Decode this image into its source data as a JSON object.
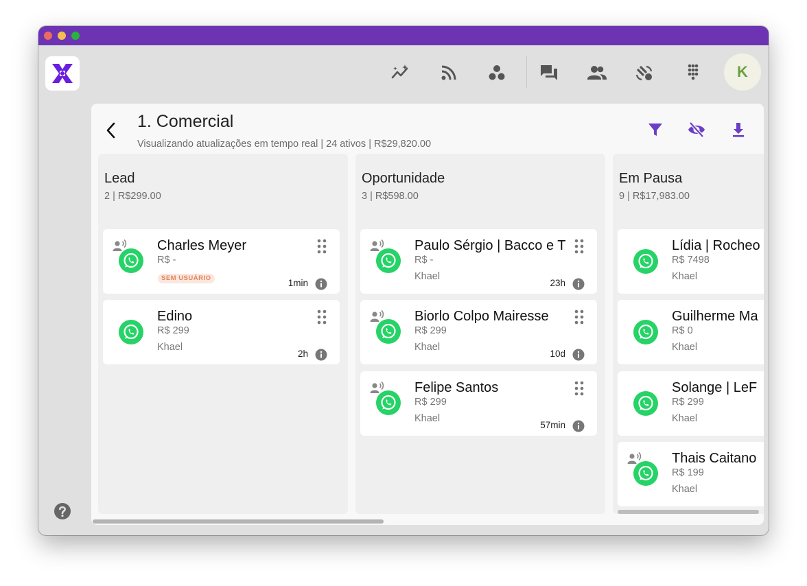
{
  "app": {
    "nav_icons": [
      "analytics-icon",
      "feed-icon",
      "workflow-icon",
      "chat-icon",
      "contacts-icon",
      "connections-icon",
      "apps-grid-icon"
    ],
    "avatar_initial": "K",
    "accent_color": "#6a3fc8",
    "titlebar_color": "#6c34b3",
    "whatsapp_color": "#25d366"
  },
  "board": {
    "title": "1. Comercial",
    "subtitle": "Visualizando atualizações em tempo real | 24 ativos | R$29,820.00",
    "columns": [
      {
        "title": "Lead",
        "meta": "2 | R$299.00",
        "cards": [
          {
            "name": "Charles Meyer",
            "value": "R$ -",
            "badge": "SEM USUÁRIO",
            "time": "1min"
          },
          {
            "name": "Edino",
            "value": "R$ 299",
            "user": "Khael",
            "time": "2h"
          }
        ]
      },
      {
        "title": "Oportunidade",
        "meta": "3 | R$598.00",
        "cards": [
          {
            "name": "Paulo Sérgio | Bacco e T",
            "value": "R$ -",
            "user": "Khael",
            "time": "23h"
          },
          {
            "name": "Biorlo Colpo Mairesse",
            "value": "R$ 299",
            "user": "Khael",
            "time": "10d"
          },
          {
            "name": "Felipe Santos",
            "value": "R$ 299",
            "user": "Khael",
            "time": "57min"
          }
        ]
      },
      {
        "title": "Em Pausa",
        "meta": "9 | R$17,983.00",
        "cards": [
          {
            "name": "Lídia | Rocheo",
            "value": "R$ 7498",
            "user": "Khael"
          },
          {
            "name": "Guilherme Ma",
            "value": "R$ 0",
            "user": "Khael"
          },
          {
            "name": "Solange | LeF",
            "value": "R$ 299",
            "user": "Khael"
          },
          {
            "name": "Thais Caitano",
            "value": "R$ 199",
            "user": "Khael"
          }
        ]
      }
    ]
  }
}
